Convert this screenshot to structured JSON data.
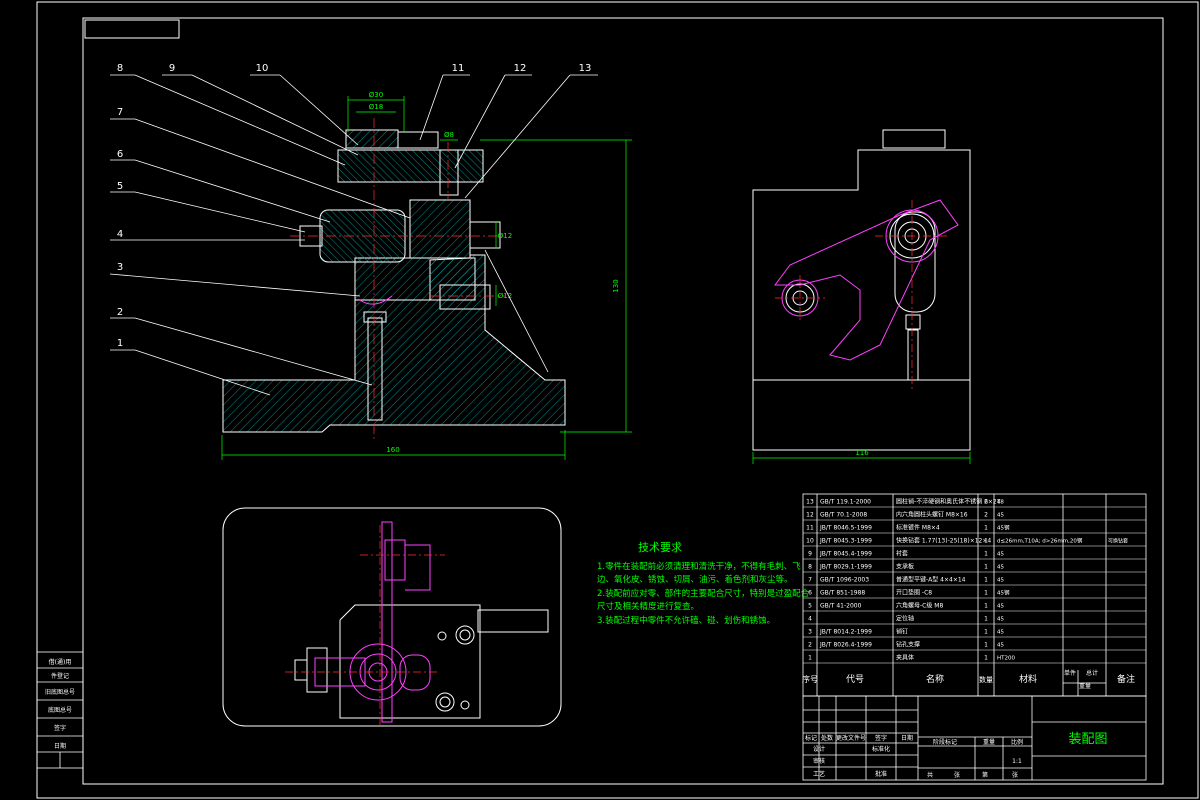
{
  "drawing": {
    "title": "装配图",
    "balloon_numbers": [
      "1",
      "2",
      "3",
      "4",
      "5",
      "6",
      "7",
      "8",
      "9",
      "10",
      "11",
      "12",
      "13"
    ],
    "dimensions": {
      "front_width": "160",
      "front_height": "130",
      "side_width": "116",
      "top_stack_1": "Ø30",
      "top_stack_2": "Ø18",
      "small_top": "Ø8",
      "right_dia_1": "Ø12",
      "right_dia_2": "Ø12"
    },
    "tech_requirements": {
      "title": "技术要求",
      "lines": [
        "1.零件在装配前必须清理和清洗干净，不得有毛刺、飞",
        "边、氧化皮、锈蚀、切屑、油污、着色剂和灰尘等。",
        "2.装配前应对零、部件的主要配合尺寸，特别是过盈配合",
        "尺寸及相关精度进行复查。",
        "3.装配过程中零件不允许磕、碰、划伤和锈蚀。"
      ]
    },
    "bom": {
      "header": {
        "seq": "序号",
        "code": "代号",
        "name": "名称",
        "qty": "数量",
        "material": "材料",
        "unit": "单件",
        "total": "总计",
        "weight": "重量",
        "remark": "备注"
      },
      "rows": [
        {
          "seq": "13",
          "code": "GB/T 119.1-2000",
          "name": "圆柱销-不淬硬钢和奥氏体不锈钢 6×24",
          "qty": "2",
          "mat": "T8",
          "remark": ""
        },
        {
          "seq": "12",
          "code": "GB/T 70.1-2008",
          "name": "内六角圆柱头螺钉 M8×16",
          "qty": "2",
          "mat": "45",
          "remark": ""
        },
        {
          "seq": "11",
          "code": "JB/T 8046.5-1999",
          "name": "标准镀件 M8×4",
          "qty": "1",
          "mat": "45钢",
          "remark": ""
        },
        {
          "seq": "10",
          "code": "JB/T 8045.3-1999",
          "name": "快换钻套 1.77(13)-25(18)×12×4",
          "qty": "1",
          "mat": "d≤26mm,T10A; d>26mm,20钢",
          "remark": "可换钻套"
        },
        {
          "seq": "9",
          "code": "JB/T 8045.4-1999",
          "name": "衬套",
          "qty": "1",
          "mat": "45",
          "remark": ""
        },
        {
          "seq": "8",
          "code": "JB/T 8029.1-1999",
          "name": "支承板",
          "qty": "1",
          "mat": "45",
          "remark": ""
        },
        {
          "seq": "7",
          "code": "GB/T 1096-2003",
          "name": "普通型平键-A型 4×4×14",
          "qty": "1",
          "mat": "45",
          "remark": ""
        },
        {
          "seq": "6",
          "code": "GB/T 851-1988",
          "name": "开口垫圈 -C8",
          "qty": "1",
          "mat": "45钢",
          "remark": ""
        },
        {
          "seq": "5",
          "code": "GB/T 41-2000",
          "name": "六角螺母-C级 M8",
          "qty": "1",
          "mat": "45",
          "remark": ""
        },
        {
          "seq": "4",
          "code": "",
          "name": "定位轴",
          "qty": "1",
          "mat": "45",
          "remark": ""
        },
        {
          "seq": "3",
          "code": "JB/T 8014.2-1999",
          "name": "销钉",
          "qty": "1",
          "mat": "45",
          "remark": ""
        },
        {
          "seq": "2",
          "code": "JB/T 8026.4-1999",
          "name": "钻孔支撑",
          "qty": "1",
          "mat": "45",
          "remark": ""
        },
        {
          "seq": "1",
          "code": "",
          "name": "夹具体",
          "qty": "1",
          "mat": "HT200",
          "remark": ""
        }
      ]
    },
    "title_block": {
      "row1": [
        "标记",
        "处数",
        "更改文件号",
        "签字",
        "日期"
      ],
      "row2": [
        "设计",
        "",
        "标准化",
        "",
        ""
      ],
      "stage_labels": [
        "阶段标记",
        "重量",
        "比例"
      ],
      "scale": "1:1",
      "sheet": [
        "共",
        "张",
        "第",
        "张"
      ],
      "extra": [
        "审核",
        "工艺",
        "",
        "批准"
      ]
    },
    "side_strip": [
      "借(通)用",
      "件登记",
      "旧底图总号",
      "底图总号",
      "签字",
      "日期"
    ]
  }
}
